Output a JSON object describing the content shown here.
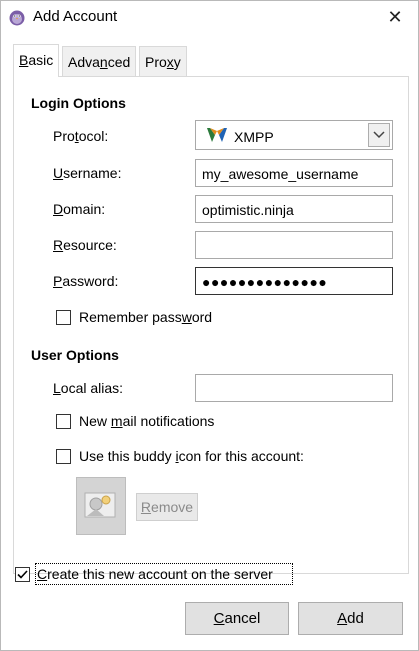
{
  "window": {
    "title": "Add Account",
    "app_icon": "pidgin-icon",
    "close_glyph": "✕"
  },
  "tabs": [
    {
      "label": "Basic",
      "accel": "B",
      "rest": "asic",
      "active": true
    },
    {
      "label": "Advanced",
      "pre": "Adva",
      "accel": "n",
      "rest": "ced",
      "active": false
    },
    {
      "label": "Proxy",
      "pre": "Pro",
      "accel": "x",
      "rest": "y",
      "active": false
    }
  ],
  "login_options": {
    "title": "Login Options",
    "protocol_label_pre": "Pro",
    "protocol_label_accel": "t",
    "protocol_label_rest": "ocol:",
    "protocol_value": "XMPP",
    "username_label_accel": "U",
    "username_label_rest": "sername:",
    "username_value": "my_awesome_username",
    "domain_label_accel": "D",
    "domain_label_rest": "omain:",
    "domain_value": "optimistic.ninja",
    "resource_label_accel": "R",
    "resource_label_rest": "esource:",
    "resource_value": "",
    "password_label_accel": "P",
    "password_label_rest": "assword:",
    "password_value": "●●●●●●●●●●●●●●",
    "remember_label_pre": "Remember pass",
    "remember_label_accel": "w",
    "remember_label_rest": "ord",
    "remember_checked": false
  },
  "user_options": {
    "title": "User Options",
    "alias_label_accel": "L",
    "alias_label_rest": "ocal alias:",
    "alias_value": "",
    "mail_label_pre": "New ",
    "mail_label_accel": "m",
    "mail_label_rest": "ail notifications",
    "mail_checked": false,
    "buddy_label_pre": "Use this buddy ",
    "buddy_label_accel": "i",
    "buddy_label_rest": "con for this account:",
    "buddy_checked": false,
    "remove_label_accel": "R",
    "remove_label_rest": "emove"
  },
  "footer": {
    "create_label_pre": "",
    "create_label_accel": "C",
    "create_label_rest": "reate this new account on the server",
    "create_checked": true,
    "cancel_label_accel": "C",
    "cancel_label_rest": "ancel",
    "add_label_accel": "A",
    "add_label_rest": "dd"
  }
}
